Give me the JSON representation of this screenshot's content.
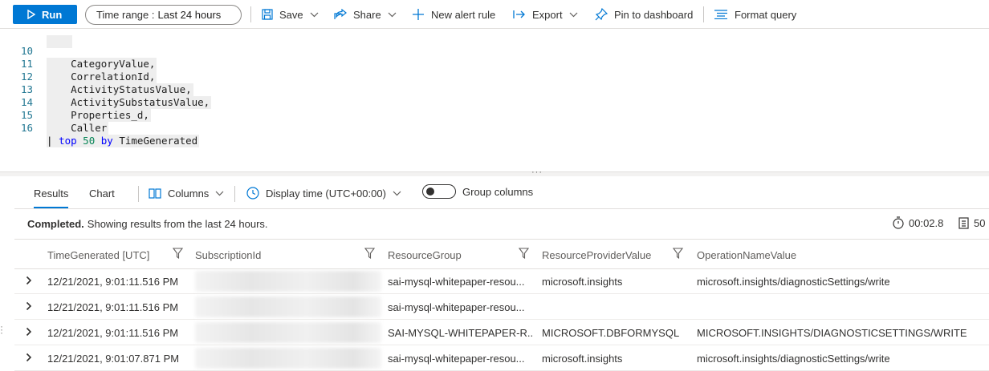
{
  "toolbar": {
    "run_label": "Run",
    "time_range_label": "Time range :",
    "time_range_value": "Last 24 hours",
    "save_label": "Save",
    "share_label": "Share",
    "new_alert_label": "New alert rule",
    "export_label": "Export",
    "pin_label": "Pin to dashboard",
    "format_label": "Format query"
  },
  "editor": {
    "lines": [
      {
        "num": "10",
        "text": "    CategoryValue,"
      },
      {
        "num": "11",
        "text": "    CorrelationId,"
      },
      {
        "num": "12",
        "text": "    ActivityStatusValue,"
      },
      {
        "num": "13",
        "text": "    ActivitySubstatusValue,"
      },
      {
        "num": "14",
        "text": "    Properties_d,"
      },
      {
        "num": "15",
        "text": "    Caller"
      }
    ],
    "last_line": {
      "num": "16",
      "pipe": "|",
      "kw1": "top",
      "num_val": "50",
      "kw2": "by",
      "field": "TimeGenerated"
    }
  },
  "results": {
    "tab_results": "Results",
    "tab_chart": "Chart",
    "columns_label": "Columns",
    "display_time_label": "Display time (UTC+00:00)",
    "group_columns_label": "Group columns",
    "status_bold": "Completed.",
    "status_text": "Showing results from the last 24 hours.",
    "duration": "00:02.8",
    "row_count": "50"
  },
  "table": {
    "headers": [
      "TimeGenerated [UTC]",
      "SubscriptionId",
      "ResourceGroup",
      "ResourceProviderValue",
      "OperationNameValue"
    ],
    "rows": [
      {
        "time": "12/21/2021, 9:01:11.516 PM",
        "rg": "sai-mysql-whitepaper-resou...",
        "provider": "microsoft.insights",
        "operation": "microsoft.insights/diagnosticSettings/write"
      },
      {
        "time": "12/21/2021, 9:01:11.516 PM",
        "rg": "sai-mysql-whitepaper-resou...",
        "provider": "",
        "operation": ""
      },
      {
        "time": "12/21/2021, 9:01:11.516 PM",
        "rg": "SAI-MYSQL-WHITEPAPER-R...",
        "provider": "MICROSOFT.DBFORMYSQL",
        "operation": "MICROSOFT.INSIGHTS/DIAGNOSTICSETTINGS/WRITE"
      },
      {
        "time": "12/21/2021, 9:01:07.871 PM",
        "rg": "sai-mysql-whitepaper-resou...",
        "provider": "microsoft.insights",
        "operation": "microsoft.insights/diagnosticSettings/write"
      }
    ]
  },
  "colors": {
    "accent": "#0078d4",
    "text": "#323130"
  }
}
